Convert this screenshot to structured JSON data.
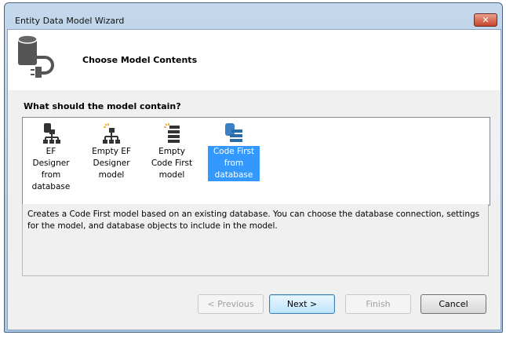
{
  "window": {
    "title": "Entity Data Model Wizard",
    "close_label": "✕"
  },
  "header": {
    "title": "Choose Model Contents"
  },
  "question": "What should the model contain?",
  "items": [
    {
      "label": "EF Designer from database",
      "icon": "database-diagram-icon",
      "selected": false
    },
    {
      "label": "Empty EF Designer model",
      "icon": "empty-diagram-icon",
      "selected": false
    },
    {
      "label": "Empty Code First model",
      "icon": "empty-code-first-icon",
      "selected": false
    },
    {
      "label": "Code First from database",
      "icon": "code-first-database-icon",
      "selected": true
    }
  ],
  "description": "Creates a Code First model based on an existing database. You can choose the database connection, settings for the model, and database objects to include in the model.",
  "buttons": {
    "previous": "< Previous",
    "next": "Next >",
    "finish": "Finish",
    "cancel": "Cancel"
  }
}
